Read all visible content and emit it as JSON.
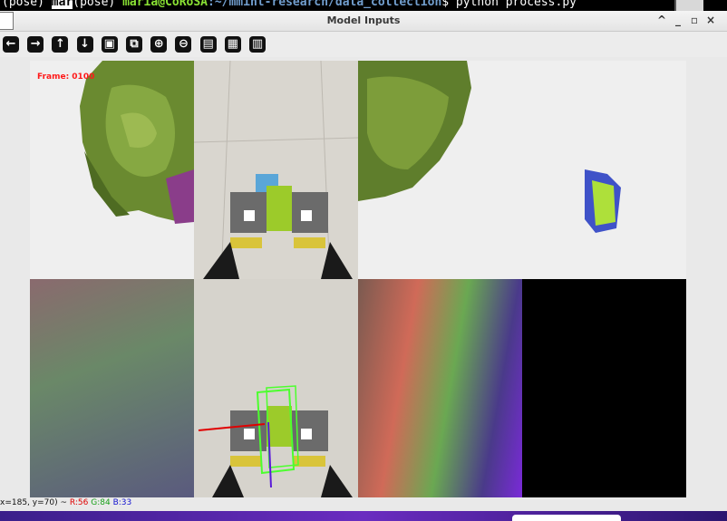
{
  "terminal": {
    "prompt_prev": "(pose) ",
    "user_prev": "mar",
    "env": "(pose) ",
    "user_host": "maria@CoRoSA",
    "path": ":~/mmint-research/data_collection",
    "command": "$ python process.py"
  },
  "window": {
    "title": "Model Inputs",
    "controls": {
      "shade": "^",
      "minimize": "_",
      "maximize": "▫",
      "close": "×"
    }
  },
  "toolbar": [
    {
      "name": "pan-left-button",
      "glyph": "←"
    },
    {
      "name": "pan-right-button",
      "glyph": "→"
    },
    {
      "name": "pan-up-button",
      "glyph": "↑"
    },
    {
      "name": "pan-down-button",
      "glyph": "↓"
    },
    {
      "name": "zoom-image-button",
      "glyph": "▣"
    },
    {
      "name": "zoom-fit-button",
      "glyph": "⧉"
    },
    {
      "name": "zoom-in-button",
      "glyph": "⊕"
    },
    {
      "name": "zoom-out-button",
      "glyph": "⊖"
    },
    {
      "name": "save-button",
      "glyph": "▤"
    },
    {
      "name": "copy-button",
      "glyph": "▦"
    },
    {
      "name": "properties-button",
      "glyph": "▥"
    }
  ],
  "overlay": {
    "frame_label": "Frame: 0100",
    "frame_color": "#ff1a1a"
  },
  "status": {
    "coords": "x=185, y=70) ~",
    "r": "R:56",
    "g": "G:84",
    "b": "B:33",
    "r_color": "#e00000",
    "g_color": "#19a019",
    "b_color": "#1414d0"
  }
}
